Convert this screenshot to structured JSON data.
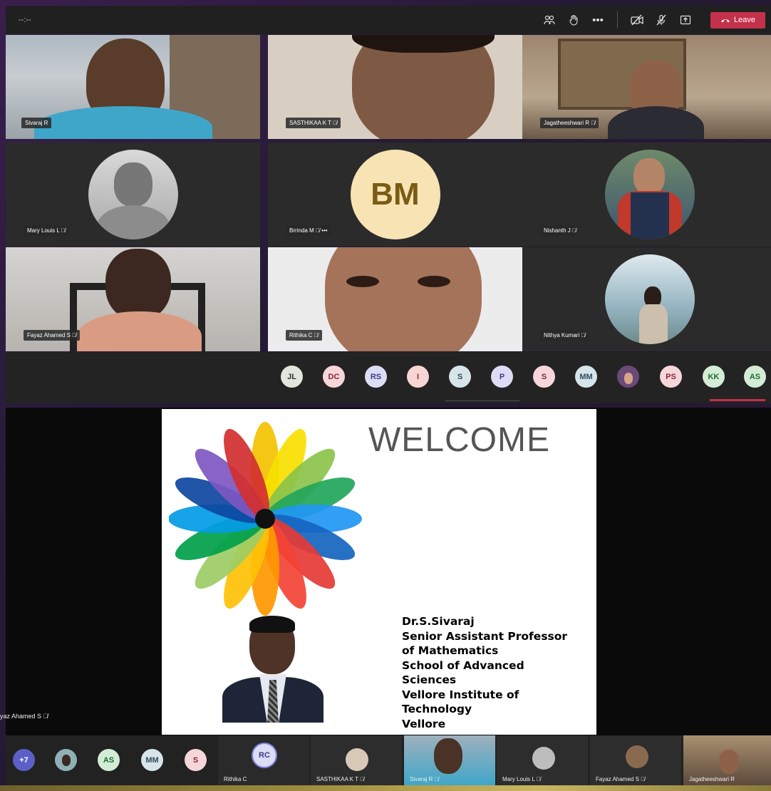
{
  "toolbar": {
    "timer": "--:--",
    "leave_label": "Leave",
    "icons": [
      "participants-icon",
      "raise-hand-icon",
      "more-icon",
      "camera-off-icon",
      "mic-off-icon",
      "share-tray-icon"
    ]
  },
  "grid": [
    {
      "name": "Sivaraj R",
      "muted": false,
      "type": "video"
    },
    {
      "name": "SASTHIKAA K T",
      "muted": true,
      "type": "video"
    },
    {
      "name": "Jagatheeshwari R",
      "muted": true,
      "type": "video"
    },
    {
      "name": "Mary Louis L",
      "muted": true,
      "type": "photo"
    },
    {
      "name": "Brrinda M",
      "muted": true,
      "type": "initials",
      "initials": "BM",
      "more": "•••"
    },
    {
      "name": "Nishanth J",
      "muted": true,
      "type": "photo"
    },
    {
      "name": "Fayaz Ahamed S",
      "muted": true,
      "type": "video"
    },
    {
      "name": "Rithika C",
      "muted": true,
      "type": "video"
    },
    {
      "name": "Nithya Kumari",
      "muted": true,
      "type": "photo"
    }
  ],
  "strip": [
    {
      "initials": "JL",
      "bg": "#e3e6dc",
      "fg": "#333"
    },
    {
      "initials": "DC",
      "bg": "#f6d6da",
      "fg": "#8a2638"
    },
    {
      "initials": "RS",
      "bg": "#dcdcf4",
      "fg": "#3b3b8a"
    },
    {
      "initials": "I",
      "bg": "#f8d5d5",
      "fg": "#a3262a"
    },
    {
      "initials": "S",
      "bg": "#d7e4ea",
      "fg": "#2d4c5e"
    },
    {
      "initials": "P",
      "bg": "#dcdcf4",
      "fg": "#3b3b8a"
    },
    {
      "initials": "S",
      "bg": "#f6d6da",
      "fg": "#8a2638"
    },
    {
      "initials": "MM",
      "bg": "#d7e4ea",
      "fg": "#2d4c5e"
    },
    {
      "initials": "",
      "bg": "#6b4a7a",
      "fg": "#fff"
    },
    {
      "initials": "PS",
      "bg": "#f6d6da",
      "fg": "#8a2638"
    },
    {
      "initials": "KK",
      "bg": "#d4ecd7",
      "fg": "#1f6b2f"
    },
    {
      "initials": "AS",
      "bg": "#d4ecd7",
      "fg": "#1f6b2f"
    }
  ],
  "slide": {
    "title": "WELCOME",
    "lines": [
      "Dr.S.Sivaraj",
      "Senior Assistant Professor",
      "of Mathematics",
      "School of Advanced",
      "Sciences",
      "Vellore Institute of",
      "Technology",
      "Vellore"
    ]
  },
  "presenter_label": "yaz Ahamed S",
  "bottom": {
    "overflow": "+7",
    "chips": [
      {
        "initials": "",
        "bg": "#9cb",
        "fg": "#333"
      },
      {
        "initials": "AS",
        "bg": "#d4ecd7",
        "fg": "#1f6b2f"
      },
      {
        "initials": "MM",
        "bg": "#d7e4ea",
        "fg": "#2d4c5e"
      },
      {
        "initials": "S",
        "bg": "#f6d6da",
        "fg": "#8a2638"
      }
    ],
    "tiles": [
      {
        "name": "Rithika C",
        "initials": "RC"
      },
      {
        "name": "SASTHIKAA K T"
      },
      {
        "name": "Sivaraj R"
      },
      {
        "name": "Mary Louis L"
      },
      {
        "name": "Fayaz Ahamed S"
      },
      {
        "name": "Jagatheeshwari R"
      }
    ]
  },
  "colors": {
    "leave": "#c4314b",
    "toolbar": "#202020",
    "accent": "#c4314b"
  }
}
